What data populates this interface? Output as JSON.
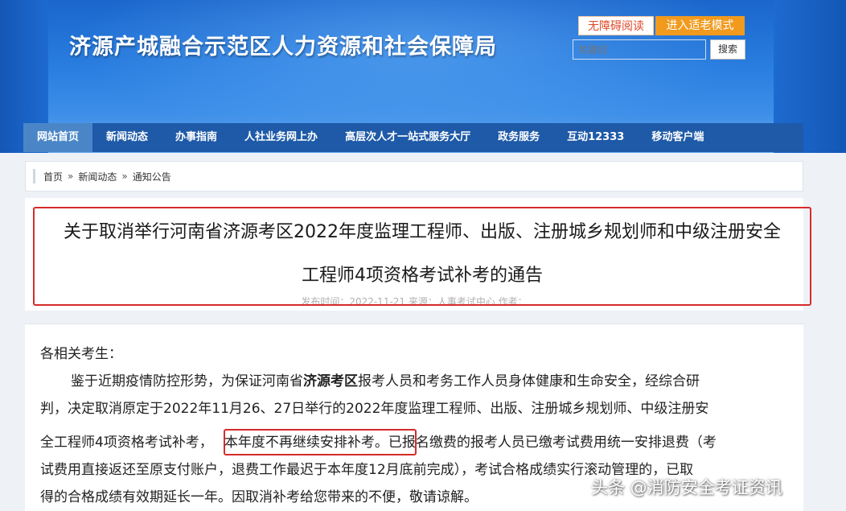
{
  "header": {
    "site_title": "济源产城融合示范区人力资源和社会保障局",
    "accessibility_button": "无障碍阅读",
    "elder_mode_button": "进入适老模式",
    "search_placeholder": "关键词",
    "search_button": "搜索"
  },
  "nav": {
    "items": [
      {
        "label": "网站首页",
        "active": true
      },
      {
        "label": "新闻动态"
      },
      {
        "label": "办事指南"
      },
      {
        "label": "人社业务网上办"
      },
      {
        "label": "高层次人才一站式服务大厅"
      },
      {
        "label": "政务服务"
      },
      {
        "label": "互动12333"
      },
      {
        "label": "移动客户端"
      }
    ]
  },
  "breadcrumb": {
    "home": "首页",
    "level1": "新闻动态",
    "level2": "通知公告",
    "separator": "»"
  },
  "article": {
    "title_line1": "关于取消举行河南省济源考区2022年度监理工程师、出版、注册城乡规划师和中级注册安全",
    "title_line2": "工程师4项资格考试补考的通告",
    "meta": "发布时间：2022-11-21  来源：人事考试中心  作者：",
    "salutation": "各相关考生：",
    "p1_a": "鉴于近期疫情防控形势，为保证河南省",
    "p1_bold": "济源考区",
    "p1_b": "报考人员和考务工作人员身体健康和生命安全，经综合研",
    "p2": "判，决定取消原定于2022年11月26、27日举行的2022年度监理工程师、出版、注册城乡规划师、中级注册安",
    "p3_a": "全工程师4项资格考试补考，",
    "p3_highlight": "本年度不再继续安排补考。",
    "p3_b": "已报名缴费的报考人员已缴考试费用统一安排退费（考",
    "p4": "试费用直接返还至原支付账户，退费工作最迟于本年度12月底前完成），考试合格成绩实行滚动管理的，已取",
    "p5": "得的合格成绩有效期延长一年。因取消补考给您带来的不便，敬请谅解。"
  },
  "watermark": "头条 @消防安全考证资讯",
  "colors": {
    "nav_bg": "#1e5aa8",
    "nav_active": "#4a86c7",
    "elder_button": "#f19a1e",
    "highlight_box": "#d62b2b"
  }
}
